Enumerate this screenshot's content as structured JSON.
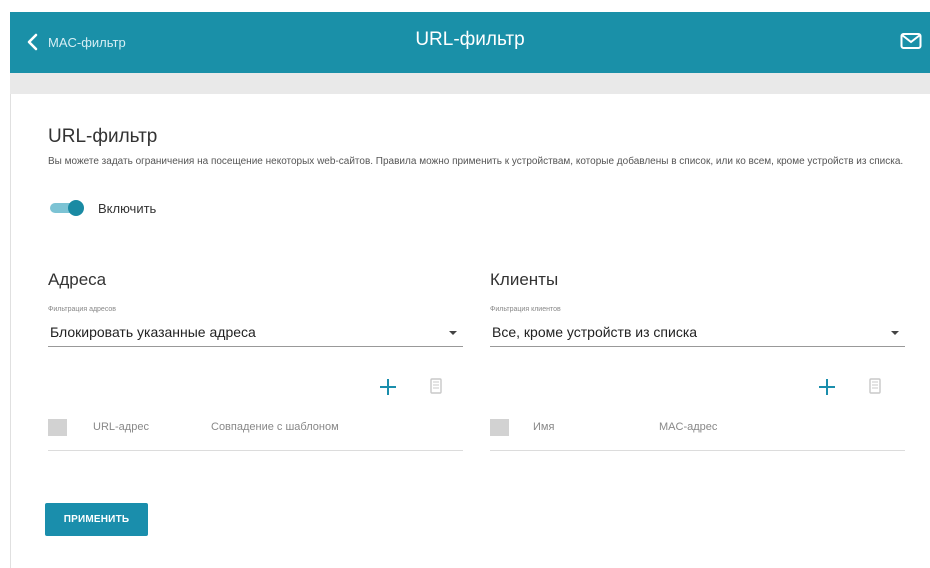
{
  "header": {
    "back_label": "MAC-фильтр",
    "title": "URL-фильтр"
  },
  "section": {
    "title": "URL-фильтр",
    "description": "Вы можете задать ограничения на посещение некоторых web-сайтов. Правила можно применить к устройствам, которые добавлены в список, или ко всем, кроме устройств из списка.",
    "toggle_label": "Включить",
    "toggle_on": true
  },
  "addresses": {
    "title": "Адреса",
    "filter_label": "Фильтрация адресов",
    "filter_value": "Блокировать указанные адреса",
    "columns": [
      "URL-адрес",
      "Совпадение с шаблоном"
    ]
  },
  "clients": {
    "title": "Клиенты",
    "filter_label": "Фильтрация клиентов",
    "filter_value": "Все, кроме устройств из списка",
    "columns": [
      "Имя",
      "MAC-адрес"
    ]
  },
  "apply_label": "ПРИМЕНИТЬ",
  "colors": {
    "header": "#1a90a8",
    "accent": "#1a8eac",
    "toggle_track": "#7cc3d4"
  },
  "icons": [
    "chevron-left-icon",
    "message-icon",
    "plus-icon",
    "trash-icon"
  ]
}
